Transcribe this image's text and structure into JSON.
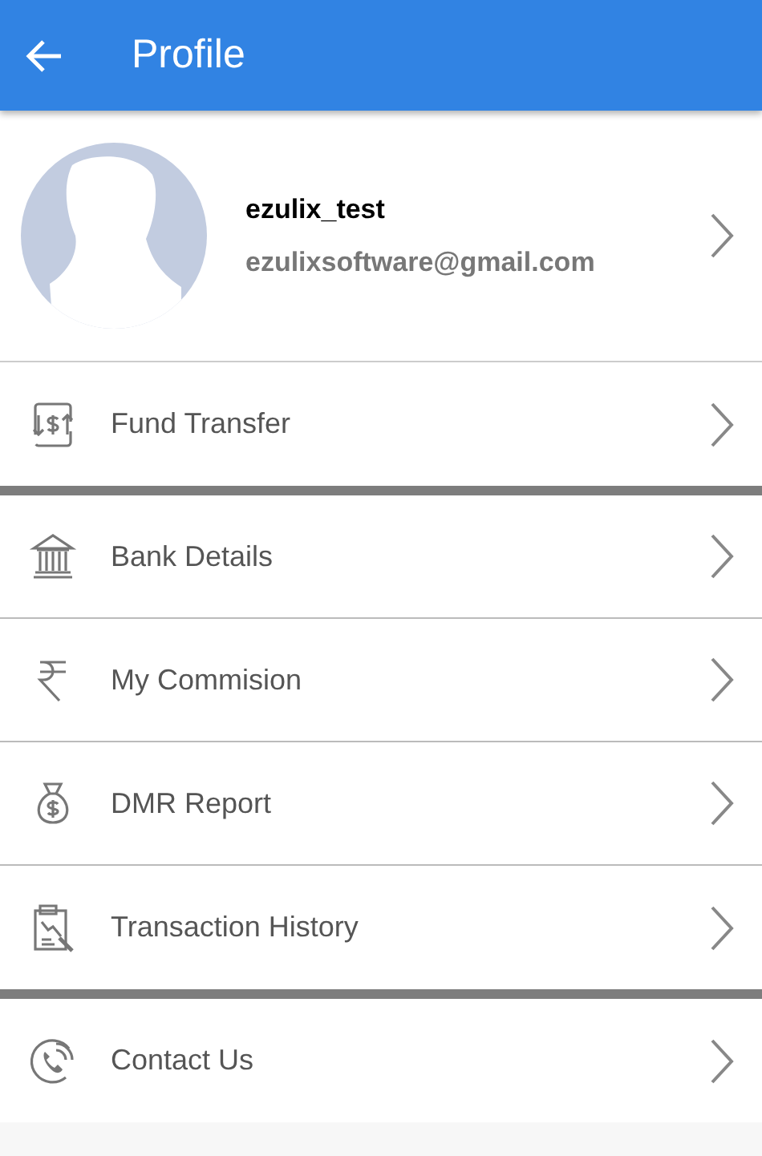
{
  "app_bar": {
    "title": "Profile"
  },
  "profile": {
    "username": "ezulix_test",
    "email": "ezulixsoftware@gmail.com"
  },
  "menu_groups": [
    {
      "items": [
        {
          "kind": "transfer",
          "label": "Fund Transfer"
        }
      ]
    },
    {
      "items": [
        {
          "kind": "bank",
          "label": "Bank Details"
        },
        {
          "kind": "rupee",
          "label": "My Commision"
        },
        {
          "kind": "moneybag",
          "label": "DMR Report"
        },
        {
          "kind": "history",
          "label": "Transaction History"
        }
      ]
    },
    {
      "items": [
        {
          "kind": "phone",
          "label": "Contact Us"
        }
      ]
    }
  ]
}
